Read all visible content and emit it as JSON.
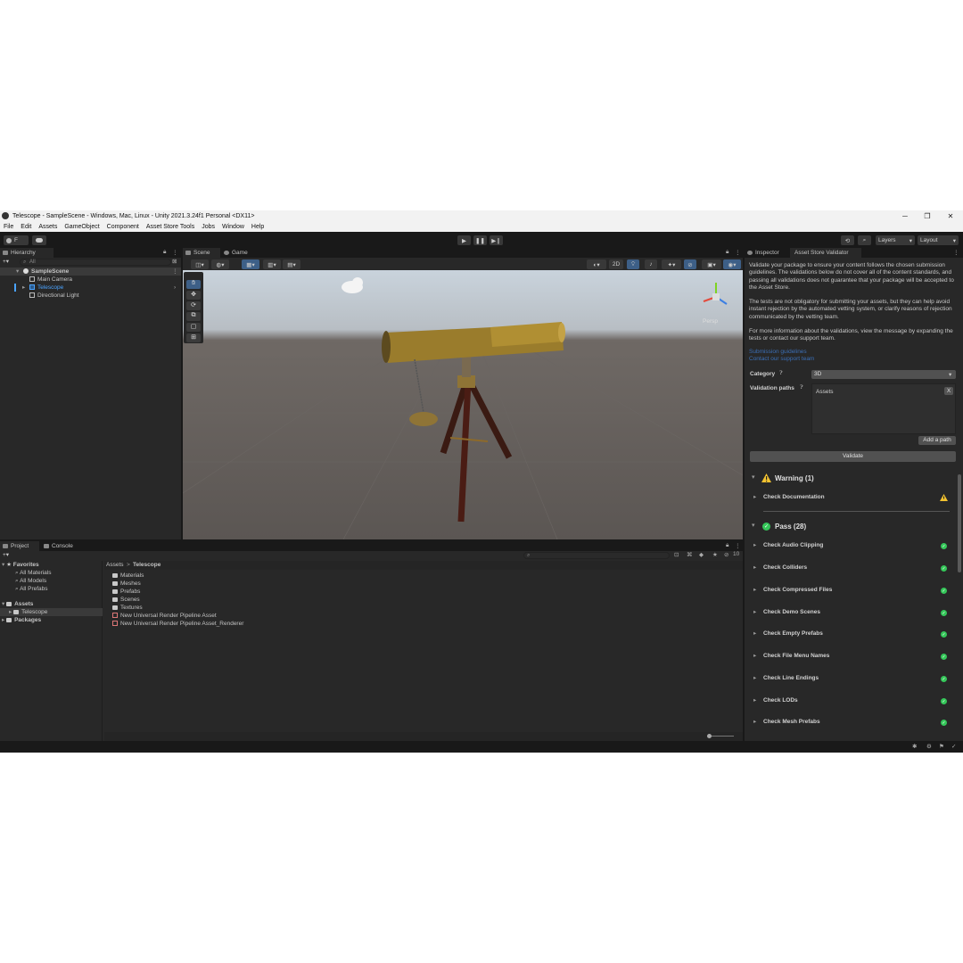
{
  "window": {
    "title": "Telescope - SampleScene - Windows, Mac, Linux - Unity 2021.3.24f1 Personal <DX11>",
    "controls": [
      "─",
      "❐",
      "✕"
    ]
  },
  "menu": [
    "File",
    "Edit",
    "Assets",
    "GameObject",
    "Component",
    "Asset Store Tools",
    "Jobs",
    "Window",
    "Help"
  ],
  "toolbar": {
    "account_label": "F",
    "layers_label": "Layers",
    "layout_label": "Layout"
  },
  "hierarchy": {
    "tab": "Hierarchy",
    "search_placeholder": "All",
    "scene": "SampleScene",
    "items": [
      "Main Camera",
      "Telescope",
      "Directional Light"
    ]
  },
  "scene_tabs": [
    "Scene",
    "Game"
  ],
  "scene_toolbar": {
    "mode_2d": "2D"
  },
  "scene_view": {
    "persp_label": "Persp"
  },
  "project": {
    "tabs": [
      "Project",
      "Console"
    ],
    "favorites_label": "Favorites",
    "favorites": [
      "All Materials",
      "All Models",
      "All Prefabs"
    ],
    "assets_label": "Assets",
    "assets_child": "Telescope",
    "packages_label": "Packages",
    "breadcrumb": [
      "Assets",
      "Telescope"
    ],
    "breadcrumb_sep": ">",
    "files": [
      "Materials",
      "Meshes",
      "Prefabs",
      "Scenes",
      "Textures",
      "New Universal Render Pipeline Asset",
      "New Universal Render Pipeline Asset_Renderer"
    ],
    "hidden_count": "10"
  },
  "validator": {
    "tabs": [
      "Inspector",
      "Asset Store Validator"
    ],
    "intro_1": "Validate your package to ensure your content follows the chosen submission guidelines. The validations below do not cover all of the content standards, and passing all validations does not guarantee that your package will be accepted to the Asset Store.",
    "intro_2": "The tests are not obligatory for submitting your assets, but they can help avoid instant rejection by the automated vetting system, or clarify reasons of rejection communicated by the vetting team.",
    "intro_3": "For more information about the validations, view the message by expanding the tests or contact our support team.",
    "link_1": "Submission guidelines",
    "link_2": "Contact our support team",
    "category_label": "Category",
    "category_value": "3D",
    "paths_label": "Validation paths",
    "path_item": "Assets",
    "path_remove": "X",
    "add_path": "Add a path",
    "validate": "Validate",
    "warning_header": "Warning (1)",
    "warning_items": [
      "Check Documentation"
    ],
    "pass_header": "Pass (28)",
    "pass_items": [
      "Check Audio Clipping",
      "Check Colliders",
      "Check Compressed Files",
      "Check Demo Scenes",
      "Check Empty Prefabs",
      "Check File Menu Names",
      "Check Line Endings",
      "Check LODs",
      "Check Mesh Prefabs"
    ]
  },
  "colors": {
    "accent": "#4aa3ff",
    "pass": "#34c759",
    "warning": "#f2c230",
    "panel": "#282828",
    "frame": "#191919"
  }
}
